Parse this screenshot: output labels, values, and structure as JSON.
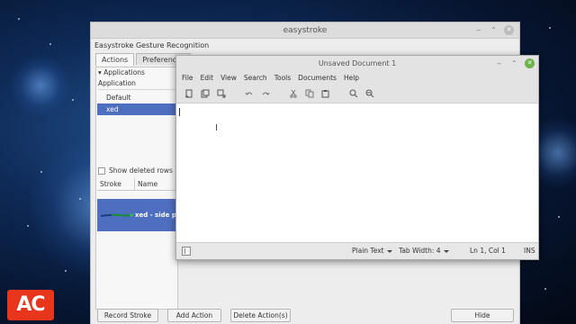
{
  "logo": {
    "text": "AC"
  },
  "easystroke": {
    "title": "easystroke",
    "header": "Easystroke Gesture Recognition",
    "tabs": [
      "Actions",
      "Preferences"
    ],
    "applications_label": "Applications",
    "application_column": "Application",
    "apps": [
      "Default",
      "xed"
    ],
    "selected_app": "xed",
    "show_deleted_label": "Show deleted rows",
    "stroke_columns": [
      "Stroke",
      "Name"
    ],
    "stroke_row": {
      "name": "xed - side pa"
    },
    "buttons": {
      "record": "Record Stroke",
      "add": "Add Action",
      "delete": "Delete Action(s)",
      "hide": "Hide"
    }
  },
  "xed": {
    "title": "Unsaved Document 1",
    "menu": [
      "File",
      "Edit",
      "View",
      "Search",
      "Tools",
      "Documents",
      "Help"
    ],
    "toolbar_icons": [
      "new-icon",
      "open-icon",
      "save-icon",
      "undo-icon",
      "redo-icon",
      "cut-icon",
      "copy-icon",
      "paste-icon",
      "search-icon",
      "replace-icon"
    ],
    "status": {
      "language": "Plain Text",
      "tab_width": "Tab Width:  4",
      "position": "Ln 1, Col 1",
      "mode": "INS"
    },
    "close_color": "#6cb34b"
  },
  "colors": {
    "selection": "#4e6fbf",
    "logo": "#e8361c"
  }
}
